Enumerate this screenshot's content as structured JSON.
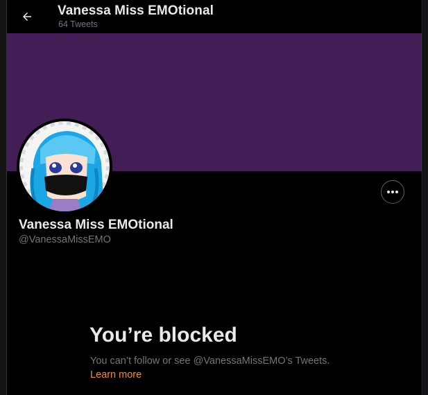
{
  "header": {
    "back_icon": "arrow-left-icon",
    "title": "Vanessa Miss EMOtional",
    "subtitle": "64 Tweets"
  },
  "profile": {
    "banner_color": "#421d56",
    "avatar_alt": "avatar",
    "name": "Vanessa Miss EMOtional",
    "handle": "@VanessaMissEMO",
    "more_icon": "more-horizontal-icon"
  },
  "blocked": {
    "title": "You’re blocked",
    "description": "You can’t follow or see @VanessaMissEMO’s Tweets.",
    "link": "Learn more",
    "link_color": "#f28c28"
  }
}
